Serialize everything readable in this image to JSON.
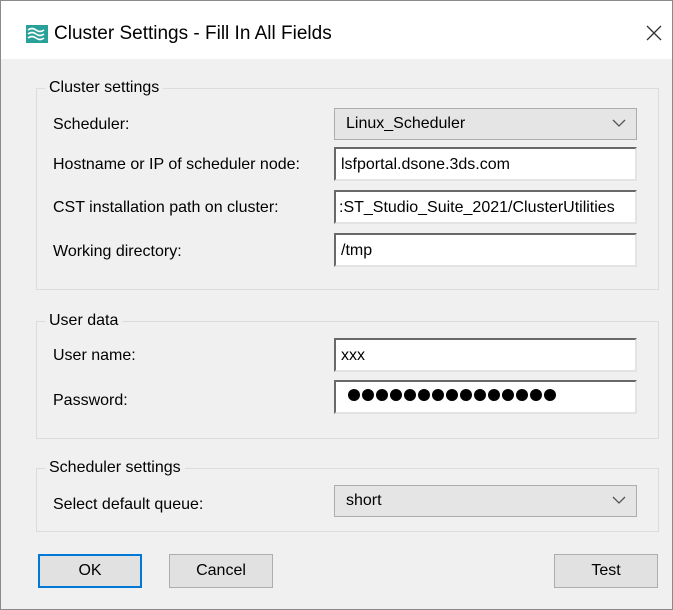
{
  "window": {
    "title": "Cluster Settings - Fill In All Fields",
    "icon": "cst-wave-icon",
    "close_icon": "close-icon"
  },
  "cluster_settings": {
    "legend": "Cluster settings",
    "scheduler_label": "Scheduler:",
    "scheduler_value": "Linux_Scheduler",
    "hostname_label": "Hostname or IP of scheduler node:",
    "hostname_value": "lsfportal.dsone.3ds.com",
    "install_path_label": "CST installation path on cluster:",
    "install_path_value": ":ST_Studio_Suite_2021/ClusterUtilities",
    "workdir_label": "Working directory:",
    "workdir_value": "/tmp"
  },
  "user_data": {
    "legend": "User data",
    "username_label": "User name:",
    "username_value": "xxx",
    "password_label": "Password:",
    "password_mask_count": 15
  },
  "scheduler_settings": {
    "legend": "Scheduler settings",
    "queue_label": "Select default queue:",
    "queue_value": "short"
  },
  "buttons": {
    "ok": "OK",
    "cancel": "Cancel",
    "test": "Test"
  },
  "colors": {
    "accent": "#0078d7",
    "icon_teal": "#2aa198"
  }
}
